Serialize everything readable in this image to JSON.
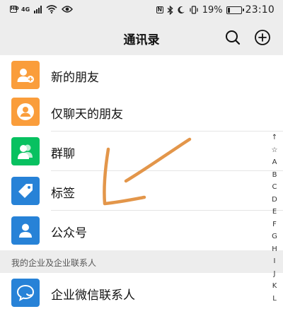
{
  "status_bar": {
    "left_badge": "HD",
    "network": "4G",
    "battery": "19%",
    "battery_level": 0.19,
    "time": "23:10"
  },
  "header": {
    "title": "通讯录"
  },
  "rows": [
    {
      "label": "新的朋友",
      "color": "#fa9d3b",
      "icon": "add-friend-icon"
    },
    {
      "label": "仅聊天的朋友",
      "color": "#fa9d3b",
      "icon": "chat-only-friend-icon"
    },
    {
      "label": "群聊",
      "color": "#07c160",
      "icon": "group-chat-icon"
    },
    {
      "label": "标签",
      "color": "#2782d7",
      "icon": "tag-icon"
    },
    {
      "label": "公众号",
      "color": "#2782d7",
      "icon": "official-account-icon"
    }
  ],
  "section": {
    "title": "我的企业及企业联系人"
  },
  "enterprise_row": {
    "label": "企业微信联系人",
    "color": "#2782d7",
    "icon": "enterprise-chat-icon"
  },
  "index_bar": [
    "↑",
    "☆",
    "A",
    "B",
    "C",
    "D",
    "E",
    "F",
    "G",
    "H",
    "I",
    "J",
    "K",
    "L"
  ],
  "annotation": {
    "stroke_color": "#e3964a"
  }
}
